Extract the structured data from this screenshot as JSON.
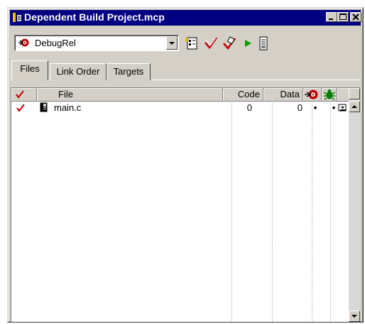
{
  "window": {
    "title": "Dependent Build Project.mcp",
    "title_icon": "project-icon",
    "controls": [
      "minimize-icon",
      "maximize-icon",
      "close-icon"
    ]
  },
  "toolbar": {
    "target_value": "DebugRel",
    "target_icon": "target-bullseye-icon",
    "tools": [
      "target-settings-icon",
      "synchronize-modification-dates-icon",
      "make-icon",
      "run-icon",
      "project-inspector-icon"
    ]
  },
  "tabs": [
    {
      "label": "Files",
      "active": true
    },
    {
      "label": "Link Order",
      "active": false
    },
    {
      "label": "Targets",
      "active": false
    }
  ],
  "columns": {
    "touch": "touch-check-icon",
    "file": "File",
    "code": "Code",
    "data": "Data",
    "target": "target-icon",
    "debug": "debug-bug-icon"
  },
  "rows": [
    {
      "touch": "check-icon",
      "icon": "file-icon",
      "file": "main.c",
      "code": "0",
      "data": "0",
      "target": "•",
      "debug": "•",
      "action": "interface-popup-icon"
    }
  ],
  "colors": {
    "titlebar": "#000080",
    "face": "#d4d0c8",
    "check_red": "#c00000",
    "bug_green": "#008000",
    "run_green": "#00a000"
  }
}
